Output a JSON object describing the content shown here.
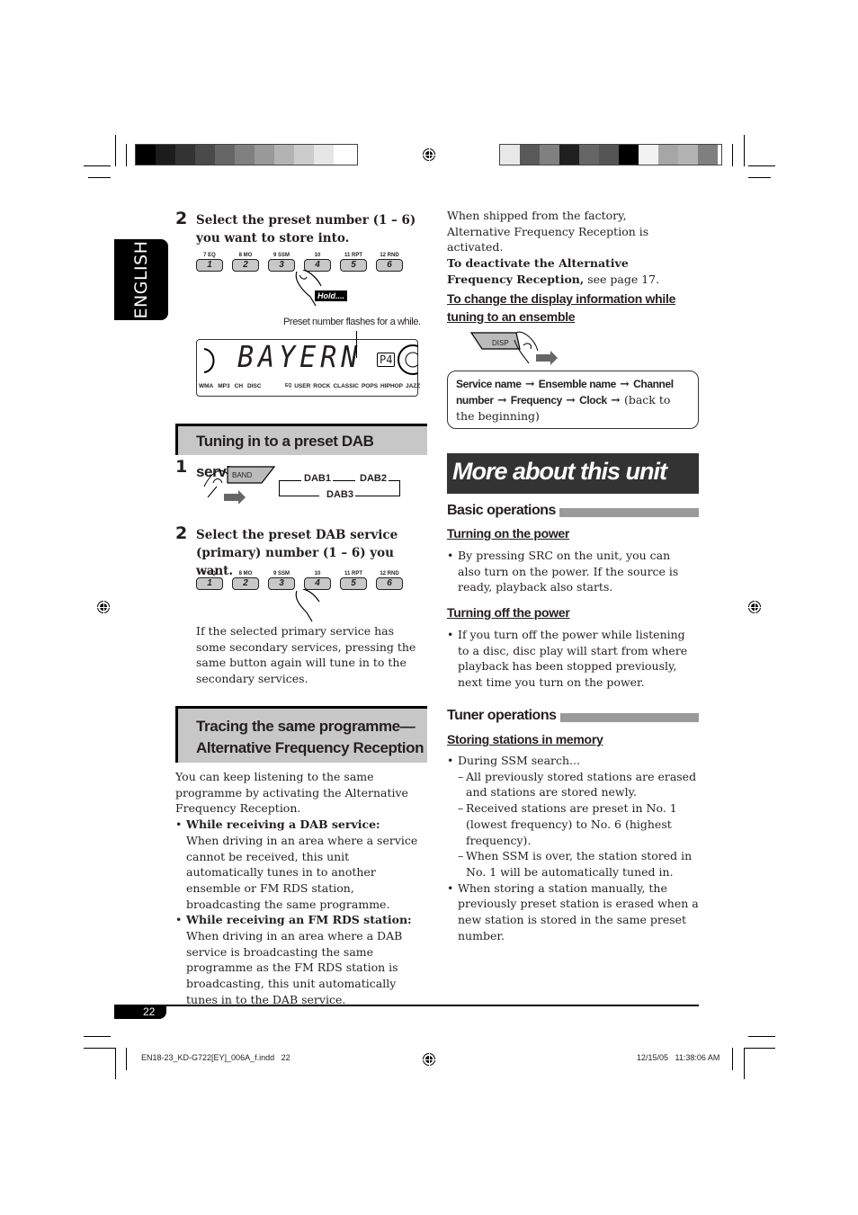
{
  "color_bars": {
    "left": [
      "#000000",
      "#1c1c1c",
      "#333333",
      "#4a4a4a",
      "#666666",
      "#808080",
      "#999999",
      "#b3b3b3",
      "#cccccc",
      "#e6e6e6",
      "#ffffff"
    ],
    "right": [
      "#e8e8e8",
      "#595959",
      "#808080",
      "#1f1f1f",
      "#666666",
      "#555555",
      "#000000",
      "#f2f2f2",
      "#a6a6a6",
      "#b3b3b3",
      "#7f7f7f"
    ]
  },
  "language_tab": "ENGLISH",
  "left_column": {
    "store_step": {
      "number": "2",
      "text": "Select the preset number (1 – 6) you want to store into.",
      "hold_label": "Hold....",
      "caption": "Preset number flashes for a while."
    },
    "preset_buttons": [
      {
        "top": "7 EQ",
        "key": "1"
      },
      {
        "top": "8 MO",
        "key": "2"
      },
      {
        "top": "9 SSM",
        "key": "3"
      },
      {
        "top": "10",
        "key": "4"
      },
      {
        "top": "11 RPT",
        "key": "5"
      },
      {
        "top": "12 RND",
        "key": "6"
      }
    ],
    "display": {
      "text": "BAYERN",
      "preset": "P4",
      "indicators": [
        "WMA",
        "MP3",
        "CH",
        "DISC"
      ],
      "eq_label": "EQ",
      "eq_modes": [
        "USER",
        "ROCK",
        "CLASSIC",
        "POPS",
        "HIPHOP",
        "JAZZ"
      ]
    },
    "section_preset_dab": {
      "title": "Tuning in to a preset DAB service",
      "step1_number": "1",
      "band_button": "BAND",
      "cycle": [
        "DAB1",
        "DAB2",
        "DAB3"
      ],
      "step2_number": "2",
      "step2_text": "Select the preset DAB service (primary) number (1 – 6) you want.",
      "note": "If the selected primary service has some secondary services, pressing the same button again will tune in to the secondary services."
    },
    "section_af": {
      "title_line1": "Tracing the same programme—",
      "title_line2": "Alternative Frequency Reception",
      "intro": "You can keep listening to the same programme by activating the Alternative Frequency Reception.",
      "bullets": [
        {
          "heading": "While receiving a DAB service:",
          "text": "When driving in an area where a service cannot be received, this unit automatically tunes in to another ensemble or FM RDS station, broadcasting the same programme."
        },
        {
          "heading": "While receiving an FM RDS station:",
          "text": "When driving in an area where a DAB service is broadcasting the same programme as the FM RDS station is broadcasting, this unit automatically tunes in to the DAB service."
        }
      ]
    }
  },
  "right_column": {
    "factory_note": "When shipped from the factory, Alternative Frequency Reception is activated.",
    "deactivate_bold": "To deactivate the Alternative Frequency Reception,",
    "deactivate_rest": " see page 17.",
    "display_change": {
      "heading": "To change the display information while tuning to an ensemble",
      "disp_button": "DISP",
      "sequence": [
        "Service name",
        "Ensemble name",
        "Channel number",
        "Frequency",
        "Clock"
      ],
      "sequence_end": "(back to the beginning)"
    },
    "more_title": "More about this unit",
    "basic": {
      "heading": "Basic operations",
      "power_on_heading": "Turning on the power",
      "power_on_text": "By pressing SRC on the unit, you can also turn on the power. If the source is ready, playback also starts.",
      "power_off_heading": "Turning off the power",
      "power_off_text": "If you turn off the power while listening to a disc, disc play will start from where playback has been stopped previously, next time you turn on the power."
    },
    "tuner": {
      "heading": "Tuner operations",
      "storing_heading": "Storing stations in memory",
      "ssm_intro": "During SSM search...",
      "ssm_items": [
        "All previously stored stations are erased and stations are stored newly.",
        "Received stations are preset in No. 1 (lowest frequency) to No. 6 (highest frequency).",
        "When SSM is over, the station stored in No. 1 will be automatically tuned in."
      ],
      "manual_text": "When storing a station manually, the previously preset station is erased when a new station is stored in the same preset number."
    }
  },
  "footer": {
    "page_number": "22",
    "file_name": "EN18-23_KD-G722[EY]_006A_f.indd   22",
    "timestamp": "12/15/05   11:38:06 AM"
  }
}
